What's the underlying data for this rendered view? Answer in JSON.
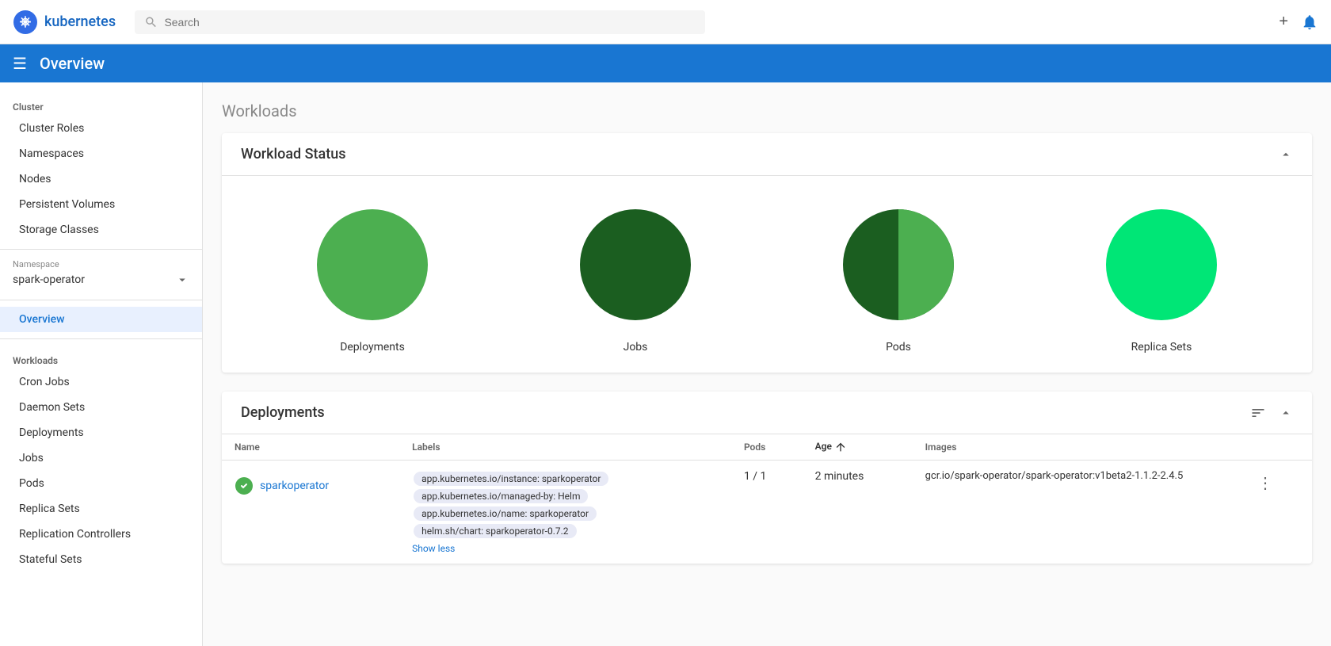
{
  "topbar": {
    "logo_text": "kubernetes",
    "search_placeholder": "Search",
    "add_icon": "+",
    "bell_icon": "🔔"
  },
  "page_header": {
    "title": "Overview"
  },
  "sidebar": {
    "cluster_label": "Cluster",
    "cluster_items": [
      {
        "label": "Cluster Roles",
        "id": "cluster-roles"
      },
      {
        "label": "Namespaces",
        "id": "namespaces"
      },
      {
        "label": "Nodes",
        "id": "nodes"
      },
      {
        "label": "Persistent Volumes",
        "id": "persistent-volumes"
      },
      {
        "label": "Storage Classes",
        "id": "storage-classes"
      }
    ],
    "namespace_label": "Namespace",
    "namespace_value": "spark-operator",
    "nav_items": [
      {
        "label": "Overview",
        "id": "overview",
        "active": true
      }
    ],
    "workloads_label": "Workloads",
    "workload_items": [
      {
        "label": "Cron Jobs",
        "id": "cron-jobs"
      },
      {
        "label": "Daemon Sets",
        "id": "daemon-sets"
      },
      {
        "label": "Deployments",
        "id": "deployments"
      },
      {
        "label": "Jobs",
        "id": "jobs"
      },
      {
        "label": "Pods",
        "id": "pods"
      },
      {
        "label": "Replica Sets",
        "id": "replica-sets"
      },
      {
        "label": "Replication Controllers",
        "id": "replication-controllers"
      },
      {
        "label": "Stateful Sets",
        "id": "stateful-sets"
      }
    ]
  },
  "content": {
    "section_title": "Workloads",
    "workload_status": {
      "title": "Workload Status",
      "charts": [
        {
          "label": "Deployments",
          "id": "deployments-chart",
          "full_pct": 100,
          "color1": "#4caf50",
          "color2": "#4caf50"
        },
        {
          "label": "Jobs",
          "id": "jobs-chart",
          "full_pct": 100,
          "color1": "#1b5e20",
          "color2": "#1b5e20"
        },
        {
          "label": "Pods",
          "id": "pods-chart",
          "full_pct": 50,
          "color1": "#4caf50",
          "color2": "#1b5e20"
        },
        {
          "label": "Replica Sets",
          "id": "replica-sets-chart",
          "full_pct": 100,
          "color1": "#4caf50",
          "color2": "#4caf50"
        }
      ]
    },
    "deployments": {
      "title": "Deployments",
      "filter_icon": "≡",
      "collapse_icon": "▲",
      "columns": [
        {
          "label": "Name",
          "key": "name"
        },
        {
          "label": "Labels",
          "key": "labels"
        },
        {
          "label": "Pods",
          "key": "pods"
        },
        {
          "label": "Age ↑",
          "key": "age",
          "sort": true
        },
        {
          "label": "Images",
          "key": "images"
        }
      ],
      "rows": [
        {
          "status": "ok",
          "name": "sparkoperator",
          "labels": [
            "app.kubernetes.io/instance: sparkoperator",
            "app.kubernetes.io/managed-by: Helm",
            "app.kubernetes.io/name: sparkoperator",
            "helm.sh/chart: sparkoperator-0.7.2"
          ],
          "show_less": "Show less",
          "pods": "1 / 1",
          "age": "2 minutes",
          "image": "gcr.io/spark-operator/spark-operator:v1beta2-1.1.2-2.4.5"
        }
      ]
    }
  }
}
